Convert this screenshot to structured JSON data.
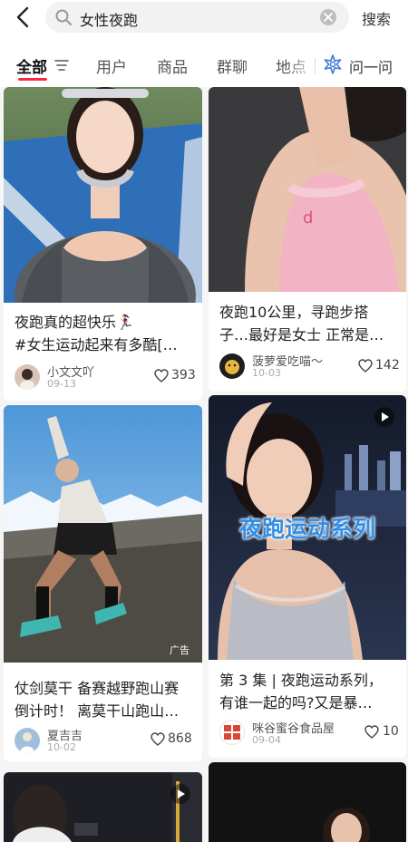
{
  "search": {
    "query": "女性夜跑",
    "button_label": "搜索"
  },
  "tabs": [
    {
      "label": "全部"
    },
    {
      "label": "用户"
    },
    {
      "label": "商品"
    },
    {
      "label": "群聊"
    },
    {
      "label": "地点"
    }
  ],
  "ask": {
    "label": "问一问"
  },
  "colors": {
    "accent": "#ff2442",
    "overlay_text": "#2f8fe8"
  },
  "cards": [
    {
      "title_line1": "夜跑真的超快乐🏃‍♀️",
      "title_line2": "#女生运动起来有多酷[…",
      "author": "小文文吖",
      "date": "09-13",
      "likes": "393"
    },
    {
      "title_line1": "夜跑10公里，寻跑步搭",
      "title_line2": "子…最好是女士 正常是…",
      "author": "菠萝爱吃喵～",
      "date": "10-03",
      "likes": "142"
    },
    {
      "title_line1": "仗剑莫干 备赛越野跑山赛",
      "title_line2": "倒计时！ 离莫干山跑山…",
      "author": "夏吉吉",
      "date": "10-02",
      "likes": "868",
      "ad_label": "广告"
    },
    {
      "title_line1": "第 3 集 | 夜跑运动系列，",
      "title_line2": "有谁一起的吗?又是暴…",
      "author": "咪谷蜜谷食品屋",
      "date": "09-04",
      "likes": "10",
      "overlay_text": "夜跑运动系列"
    }
  ]
}
